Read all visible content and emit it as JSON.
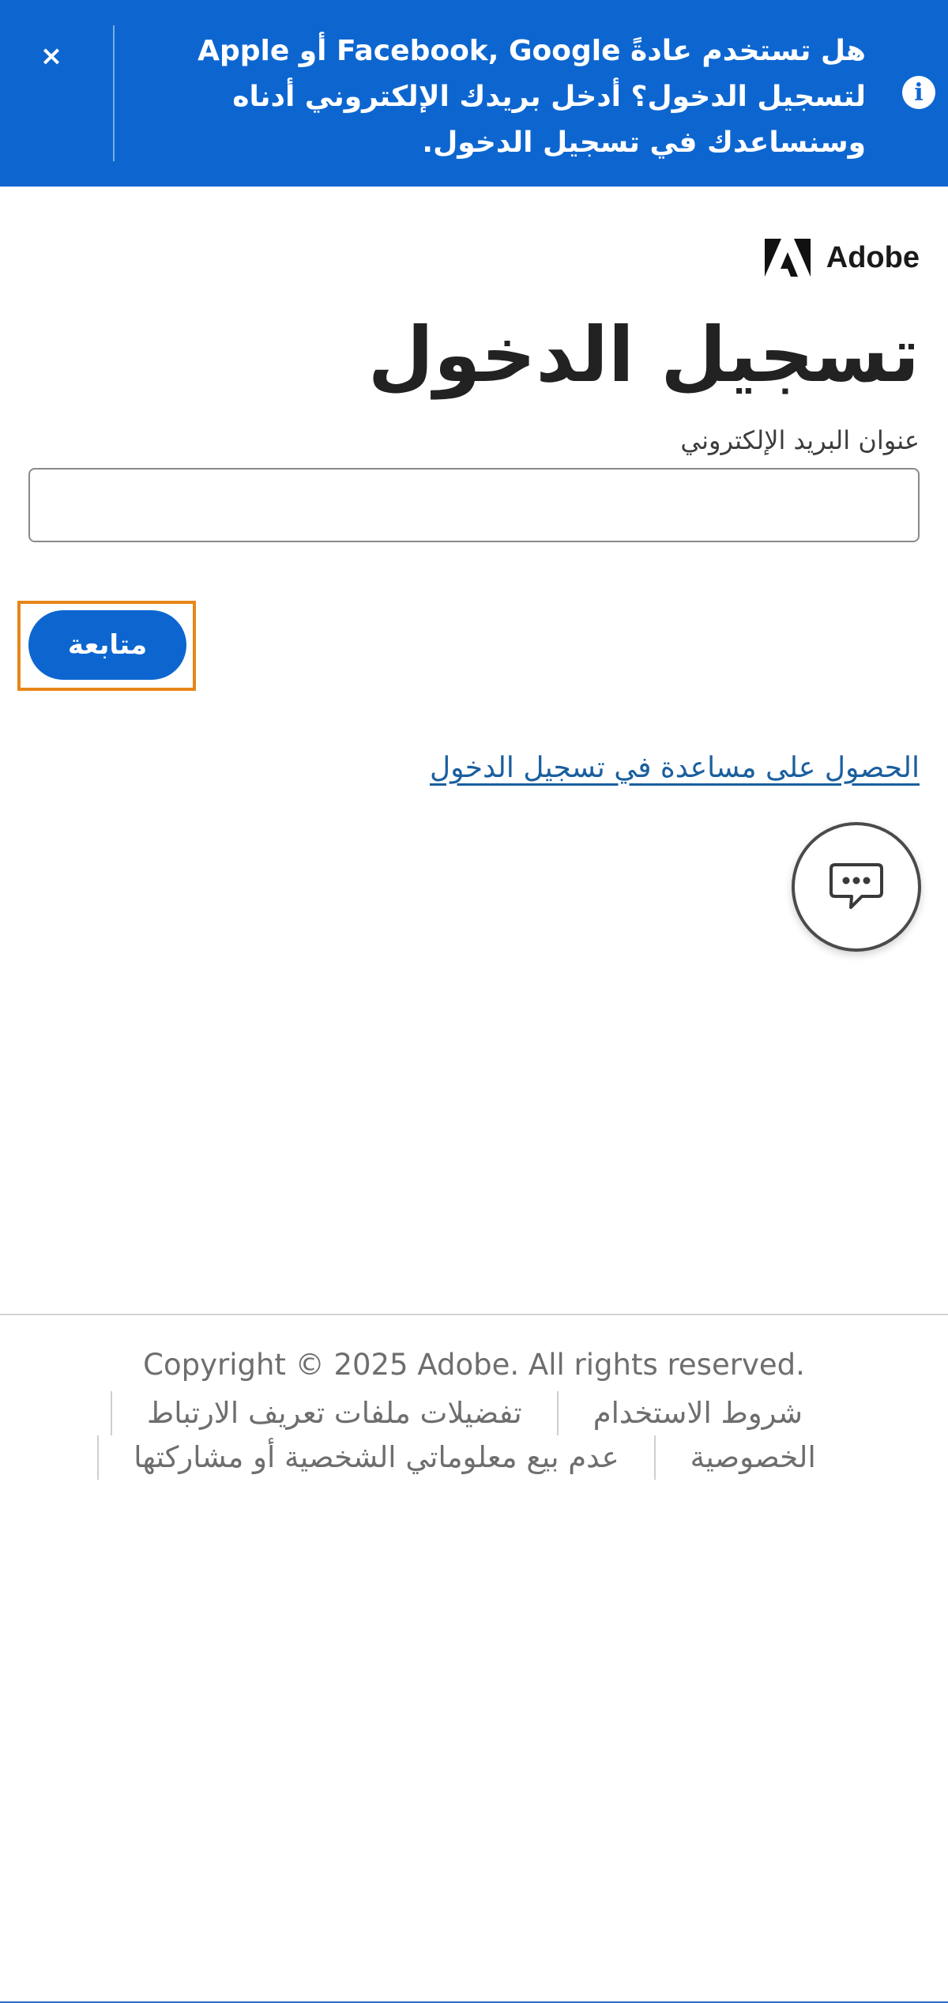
{
  "banner": {
    "message": "هل تستخدم عادةً Facebook, Google أو Apple لتسجيل الدخول؟ أدخل بريدك الإلكتروني أدناه وسنساعدك في تسجيل الدخول.",
    "info_icon": "info-icon",
    "close_icon": "close-icon",
    "close_glyph": "×",
    "background_color": "#0d66d0"
  },
  "brand": {
    "name": "Adobe",
    "logo_icon": "adobe-logo-icon"
  },
  "signin": {
    "title": "تسجيل الدخول",
    "email_label": "عنوان البريد الإلكتروني",
    "email_value": "",
    "continue_label": "متابعة",
    "help_link": "الحصول على مساعدة في تسجيل الدخول",
    "accent_color": "#0d66d0",
    "focus_ring_color": "#e68619"
  },
  "chat": {
    "icon": "chat-bubble-icon"
  },
  "footer": {
    "copyright": "Copyright © 2025 Adobe. All rights reserved.",
    "links": {
      "terms": "شروط الاستخدام",
      "cookies": "تفضيلات ملفات تعريف الارتباط",
      "privacy": "الخصوصية",
      "do_not_sell": "عدم بيع معلوماتي الشخصية أو مشاركتها"
    }
  }
}
